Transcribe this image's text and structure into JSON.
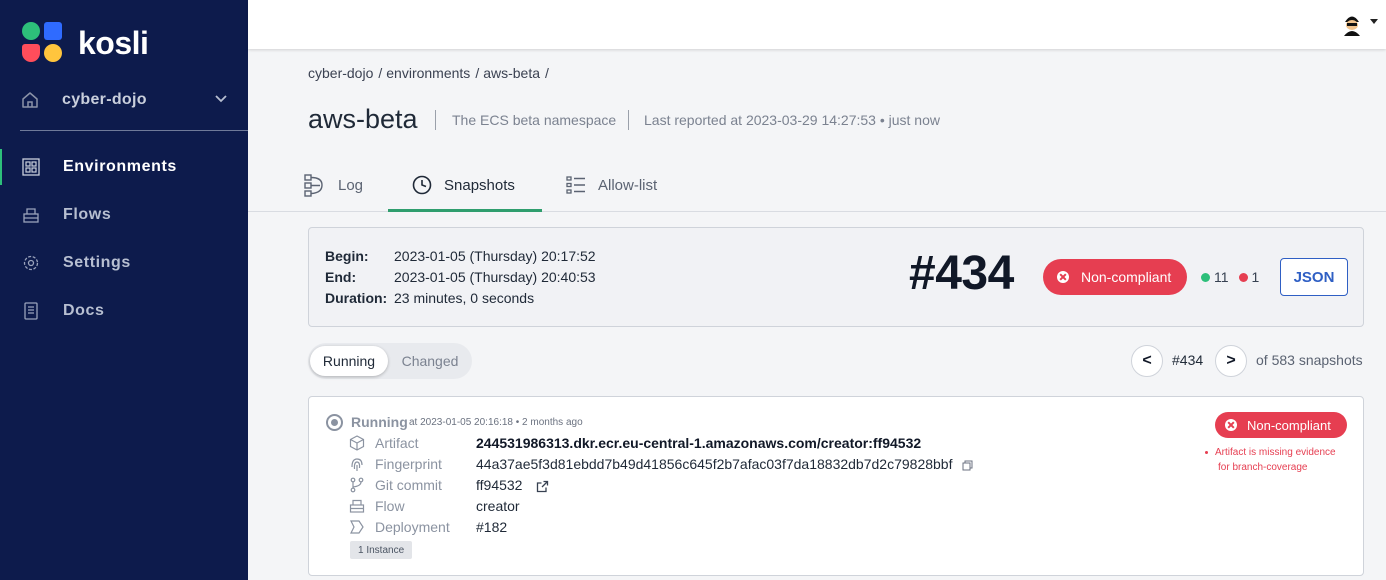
{
  "brand": {
    "name": "kosli"
  },
  "sidebar": {
    "org": "cyber-dojo",
    "items": [
      {
        "label": "Environments",
        "icon": "grid-icon",
        "active": true
      },
      {
        "label": "Flows",
        "icon": "flow-icon",
        "active": false
      },
      {
        "label": "Settings",
        "icon": "gear-icon",
        "active": false
      },
      {
        "label": "Docs",
        "icon": "docs-icon",
        "active": false
      }
    ]
  },
  "breadcrumb": [
    "cyber-dojo",
    "environments",
    "aws-beta"
  ],
  "environment": {
    "name": "aws-beta",
    "description": "The ECS beta namespace",
    "last_reported": "Last reported at 2023-03-29 14:27:53 • just now"
  },
  "tabs": [
    {
      "label": "Log",
      "icon": "log-icon",
      "active": false
    },
    {
      "label": "Snapshots",
      "icon": "clock-icon",
      "active": true
    },
    {
      "label": "Allow-list",
      "icon": "list-icon",
      "active": false
    }
  ],
  "snapshot": {
    "begin_label": "Begin:",
    "begin": "2023-01-05 (Thursday) 20:17:52",
    "end_label": "End:",
    "end": "2023-01-05 (Thursday) 20:40:53",
    "duration_label": "Duration:",
    "duration": "23 minutes, 0 seconds",
    "number": "#434",
    "status": "Non-compliant",
    "compliant_count": "11",
    "noncompliant_count": "1",
    "json_label": "JSON"
  },
  "toggle": {
    "running": "Running",
    "changed": "Changed"
  },
  "pager": {
    "prev": "<",
    "next": ">",
    "current": "#434",
    "total": "of 583 snapshots"
  },
  "artifact": {
    "state": "Running",
    "meta": "at 2023-01-05 20:16:18 • 2 months ago",
    "status": "Non-compliant",
    "reason_line1": "Artifact is missing evidence",
    "reason_line2": "for branch-coverage",
    "fields": {
      "artifact_label": "Artifact",
      "artifact": "244531986313.dkr.ecr.eu-central-1.amazonaws.com/creator:ff94532",
      "fingerprint_label": "Fingerprint",
      "fingerprint": "44a37ae5f3d81ebdd7b49d41856c645f2b7afac03f7da18832db7d2c79828bbf",
      "commit_label": "Git commit",
      "commit": "ff94532",
      "flow_label": "Flow",
      "flow": "creator",
      "deployment_label": "Deployment",
      "deployment": "#182"
    },
    "instances": "1 Instance"
  },
  "colors": {
    "sidebar_bg": "#0d1b4c",
    "active_accent": "#2dbf7a",
    "non_compliant": "#e63e51",
    "primary_blue": "#2f5fc4"
  }
}
